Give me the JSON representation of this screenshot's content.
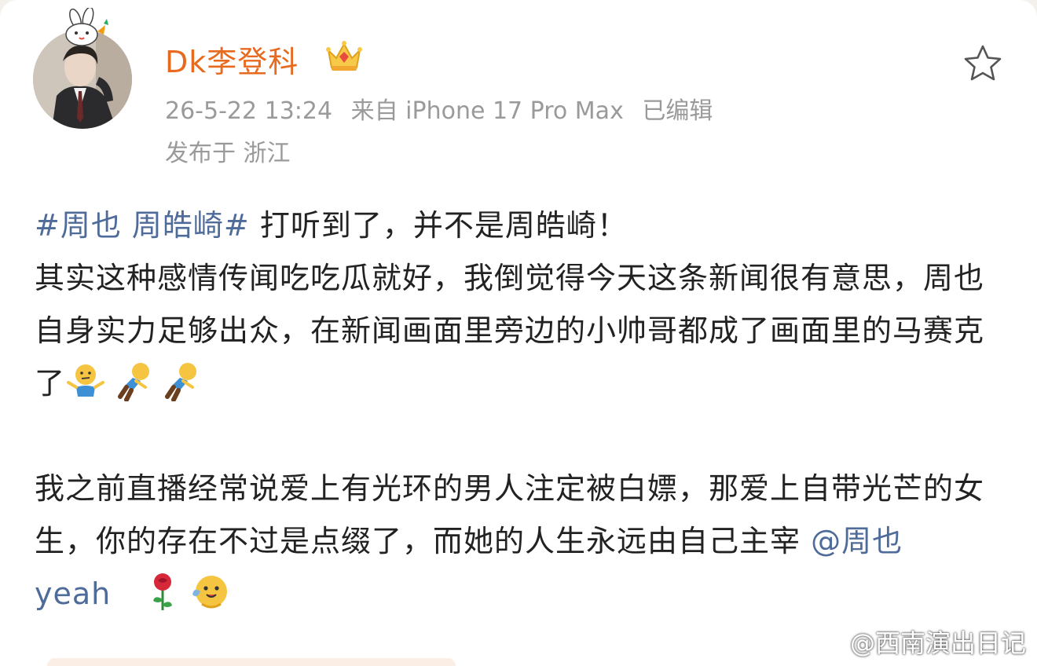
{
  "post": {
    "author": {
      "name": "Dk李登科",
      "badge_icon": "crown-icon",
      "avatar_pendant_icon": "rabbit-pendant-icon"
    },
    "timestamp": "26-5-22 13:24",
    "source": "来自 iPhone 17 Pro Max",
    "edited": "已编辑",
    "location": "发布于 浙江",
    "favorite_icon": "star-outline-icon",
    "body": {
      "hashtag": "#周也 周皓崎#",
      "line1_rest": " 打听到了，并不是周皓崎！",
      "para1": "其实这种感情传闻吃吃瓜就好，我倒觉得今天这条新闻很有意思，周也自身实力足够出众，在新闻画面里旁边的小帅哥都成了画面里的马赛克了",
      "para1_emojis": [
        "shrug-emoji",
        "kneeling-emoji",
        "kneeling-emoji"
      ],
      "para2": "我之前直播经常说爱上有光环的男人注定被白嫖，那爱上自带光芒的女生，你的存在不过是点缀了，而她的人生永远由自己主宰 ",
      "mention": "@周也 yeah",
      "para2_emojis": [
        "rose-emoji",
        "hug-emoji"
      ]
    }
  },
  "watermark": {
    "text": "@西南演出日记",
    "logo_icon": "weibo-logo-icon"
  },
  "colors": {
    "username": "#e86a1e",
    "link": "#4e6b99",
    "meta": "#9a9a9a",
    "text": "#222222"
  }
}
